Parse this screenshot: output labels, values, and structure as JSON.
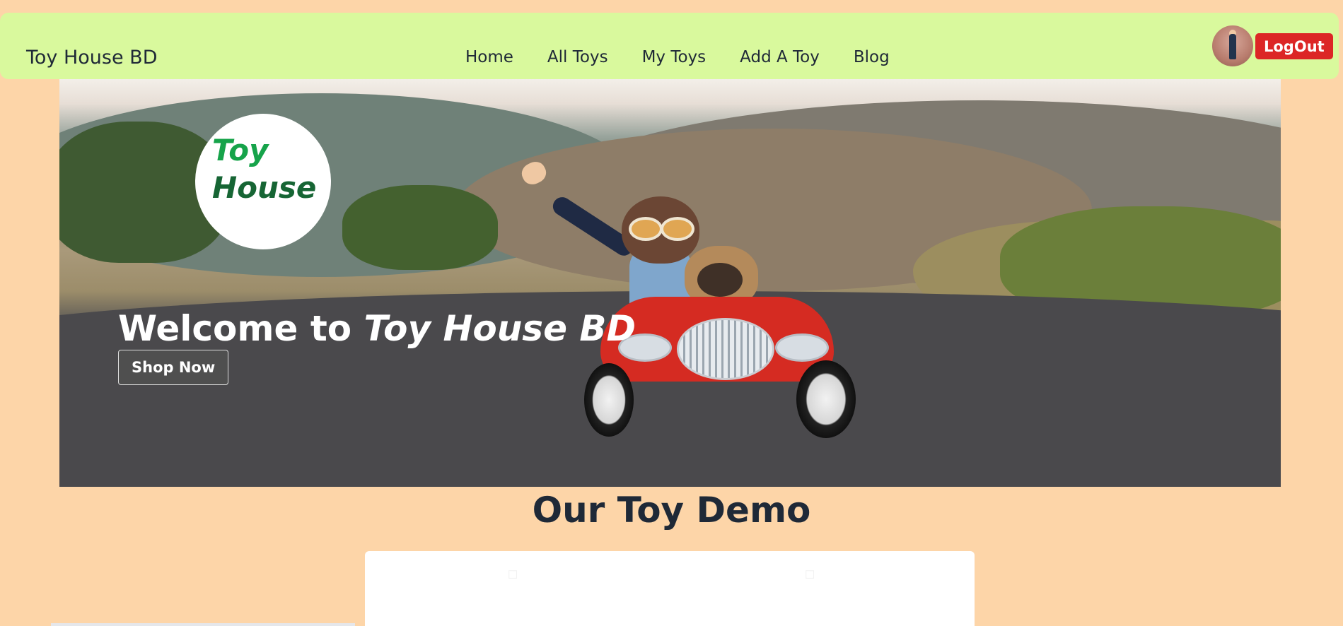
{
  "header": {
    "brand": "Toy House BD",
    "nav": [
      "Home",
      "All Toys",
      "My Toys",
      "Add A Toy",
      "Blog"
    ],
    "logout_label": "LogOut"
  },
  "hero": {
    "logo_line1": "Toy",
    "logo_line2": "House",
    "welcome_prefix": "Welcome to",
    "welcome_brand": "Toy House BD",
    "cta_label": "Shop Now"
  },
  "section": {
    "title": "Our Toy Demo"
  },
  "colors": {
    "page_bg": "#fdd5a8",
    "navbar_bg": "#d9f99d",
    "logout_bg": "#dc2626",
    "logo_green_light": "#16a34a",
    "logo_green_dark": "#166534"
  },
  "icons": {
    "avatar": "user-avatar"
  }
}
